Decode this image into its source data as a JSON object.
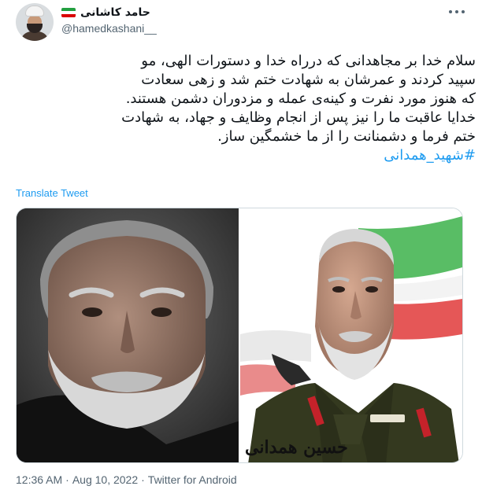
{
  "author": {
    "name": "حامد کاشانی",
    "handle": "@hamedkashani__",
    "flag_colors": [
      "#239f40",
      "#ffffff",
      "#da0000"
    ]
  },
  "tweet": {
    "lines": [
      "سلام خدا بر مجاهدانی که درراه خدا و دستورات الهی، مو",
      "سپید کردند و عمرشان به شهادت ختم شد و زهی سعادت",
      "که هنوز مورد نفرت و کینه‌ی عمله و مزدوران دشمن هستند.",
      "خدایا عاقبت ما را نیز پس از انجام وظایف و جهاد، به شهادت",
      "ختم فرما و دشمنانت را از ما خشمگین ساز."
    ],
    "hashtag": "#شهید_همدانی",
    "translate_label": "Translate Tweet",
    "photo_signature": "حسین همدانی",
    "name_tag": "حسین همدانی"
  },
  "meta": {
    "time": "12:36 AM",
    "separator": "·",
    "date": "Aug 10, 2022",
    "source": "Twitter for Android"
  },
  "colors": {
    "link": "#1d9bf0",
    "secondary_text": "#536471",
    "primary_text": "#0f1419",
    "border": "#cfd9de"
  },
  "icons": {
    "more": "more-horizontal-icon",
    "flag": "iran-flag-icon"
  }
}
